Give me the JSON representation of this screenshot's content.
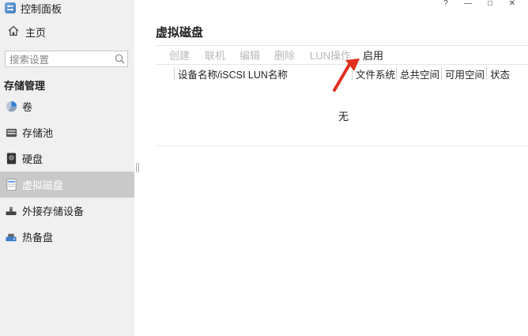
{
  "app": {
    "title": "控制面板"
  },
  "window_controls": {
    "help": "?",
    "minimize": "—",
    "maximize": "□",
    "close": "✕"
  },
  "sidebar": {
    "home_label": "主页",
    "search_placeholder": "搜索设置",
    "section_title": "存储管理",
    "items": [
      {
        "label": "卷",
        "icon": "pie-icon"
      },
      {
        "label": "存储池",
        "icon": "storage-pool-icon"
      },
      {
        "label": "硬盘",
        "icon": "hard-disk-icon"
      },
      {
        "label": "虚拟磁盘",
        "icon": "virtual-disk-icon",
        "selected": true
      },
      {
        "label": "外接存储设备",
        "icon": "external-storage-icon"
      },
      {
        "label": "热备盘",
        "icon": "hot-spare-icon"
      }
    ]
  },
  "main": {
    "title": "虚拟磁盘",
    "toolbar": {
      "create": "创建",
      "connect": "联机",
      "edit": "编辑",
      "delete": "删除",
      "lun_ops": "LUN操作",
      "enable": "启用"
    },
    "columns": [
      "设备名称/iSCSI LUN名称",
      "文件系统",
      "总共空间",
      "可用空间",
      "状态"
    ],
    "empty_text": "无"
  },
  "colors": {
    "sidebar_bg": "#f0f0f0",
    "selected_bg": "#c9c9c9",
    "disabled_text": "#b8b8b8",
    "annotation_arrow": "#e03020"
  }
}
